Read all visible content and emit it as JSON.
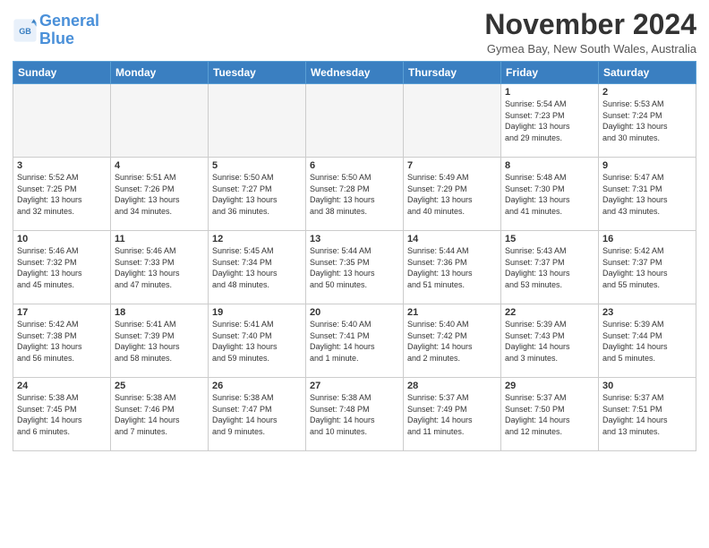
{
  "header": {
    "logo_general": "General",
    "logo_blue": "Blue",
    "month_title": "November 2024",
    "location": "Gymea Bay, New South Wales, Australia"
  },
  "days_of_week": [
    "Sunday",
    "Monday",
    "Tuesday",
    "Wednesday",
    "Thursday",
    "Friday",
    "Saturday"
  ],
  "weeks": [
    [
      {
        "day": "",
        "info": ""
      },
      {
        "day": "",
        "info": ""
      },
      {
        "day": "",
        "info": ""
      },
      {
        "day": "",
        "info": ""
      },
      {
        "day": "",
        "info": ""
      },
      {
        "day": "1",
        "info": "Sunrise: 5:54 AM\nSunset: 7:23 PM\nDaylight: 13 hours\nand 29 minutes."
      },
      {
        "day": "2",
        "info": "Sunrise: 5:53 AM\nSunset: 7:24 PM\nDaylight: 13 hours\nand 30 minutes."
      }
    ],
    [
      {
        "day": "3",
        "info": "Sunrise: 5:52 AM\nSunset: 7:25 PM\nDaylight: 13 hours\nand 32 minutes."
      },
      {
        "day": "4",
        "info": "Sunrise: 5:51 AM\nSunset: 7:26 PM\nDaylight: 13 hours\nand 34 minutes."
      },
      {
        "day": "5",
        "info": "Sunrise: 5:50 AM\nSunset: 7:27 PM\nDaylight: 13 hours\nand 36 minutes."
      },
      {
        "day": "6",
        "info": "Sunrise: 5:50 AM\nSunset: 7:28 PM\nDaylight: 13 hours\nand 38 minutes."
      },
      {
        "day": "7",
        "info": "Sunrise: 5:49 AM\nSunset: 7:29 PM\nDaylight: 13 hours\nand 40 minutes."
      },
      {
        "day": "8",
        "info": "Sunrise: 5:48 AM\nSunset: 7:30 PM\nDaylight: 13 hours\nand 41 minutes."
      },
      {
        "day": "9",
        "info": "Sunrise: 5:47 AM\nSunset: 7:31 PM\nDaylight: 13 hours\nand 43 minutes."
      }
    ],
    [
      {
        "day": "10",
        "info": "Sunrise: 5:46 AM\nSunset: 7:32 PM\nDaylight: 13 hours\nand 45 minutes."
      },
      {
        "day": "11",
        "info": "Sunrise: 5:46 AM\nSunset: 7:33 PM\nDaylight: 13 hours\nand 47 minutes."
      },
      {
        "day": "12",
        "info": "Sunrise: 5:45 AM\nSunset: 7:34 PM\nDaylight: 13 hours\nand 48 minutes."
      },
      {
        "day": "13",
        "info": "Sunrise: 5:44 AM\nSunset: 7:35 PM\nDaylight: 13 hours\nand 50 minutes."
      },
      {
        "day": "14",
        "info": "Sunrise: 5:44 AM\nSunset: 7:36 PM\nDaylight: 13 hours\nand 51 minutes."
      },
      {
        "day": "15",
        "info": "Sunrise: 5:43 AM\nSunset: 7:37 PM\nDaylight: 13 hours\nand 53 minutes."
      },
      {
        "day": "16",
        "info": "Sunrise: 5:42 AM\nSunset: 7:37 PM\nDaylight: 13 hours\nand 55 minutes."
      }
    ],
    [
      {
        "day": "17",
        "info": "Sunrise: 5:42 AM\nSunset: 7:38 PM\nDaylight: 13 hours\nand 56 minutes."
      },
      {
        "day": "18",
        "info": "Sunrise: 5:41 AM\nSunset: 7:39 PM\nDaylight: 13 hours\nand 58 minutes."
      },
      {
        "day": "19",
        "info": "Sunrise: 5:41 AM\nSunset: 7:40 PM\nDaylight: 13 hours\nand 59 minutes."
      },
      {
        "day": "20",
        "info": "Sunrise: 5:40 AM\nSunset: 7:41 PM\nDaylight: 14 hours\nand 1 minute."
      },
      {
        "day": "21",
        "info": "Sunrise: 5:40 AM\nSunset: 7:42 PM\nDaylight: 14 hours\nand 2 minutes."
      },
      {
        "day": "22",
        "info": "Sunrise: 5:39 AM\nSunset: 7:43 PM\nDaylight: 14 hours\nand 3 minutes."
      },
      {
        "day": "23",
        "info": "Sunrise: 5:39 AM\nSunset: 7:44 PM\nDaylight: 14 hours\nand 5 minutes."
      }
    ],
    [
      {
        "day": "24",
        "info": "Sunrise: 5:38 AM\nSunset: 7:45 PM\nDaylight: 14 hours\nand 6 minutes."
      },
      {
        "day": "25",
        "info": "Sunrise: 5:38 AM\nSunset: 7:46 PM\nDaylight: 14 hours\nand 7 minutes."
      },
      {
        "day": "26",
        "info": "Sunrise: 5:38 AM\nSunset: 7:47 PM\nDaylight: 14 hours\nand 9 minutes."
      },
      {
        "day": "27",
        "info": "Sunrise: 5:38 AM\nSunset: 7:48 PM\nDaylight: 14 hours\nand 10 minutes."
      },
      {
        "day": "28",
        "info": "Sunrise: 5:37 AM\nSunset: 7:49 PM\nDaylight: 14 hours\nand 11 minutes."
      },
      {
        "day": "29",
        "info": "Sunrise: 5:37 AM\nSunset: 7:50 PM\nDaylight: 14 hours\nand 12 minutes."
      },
      {
        "day": "30",
        "info": "Sunrise: 5:37 AM\nSunset: 7:51 PM\nDaylight: 14 hours\nand 13 minutes."
      }
    ]
  ]
}
